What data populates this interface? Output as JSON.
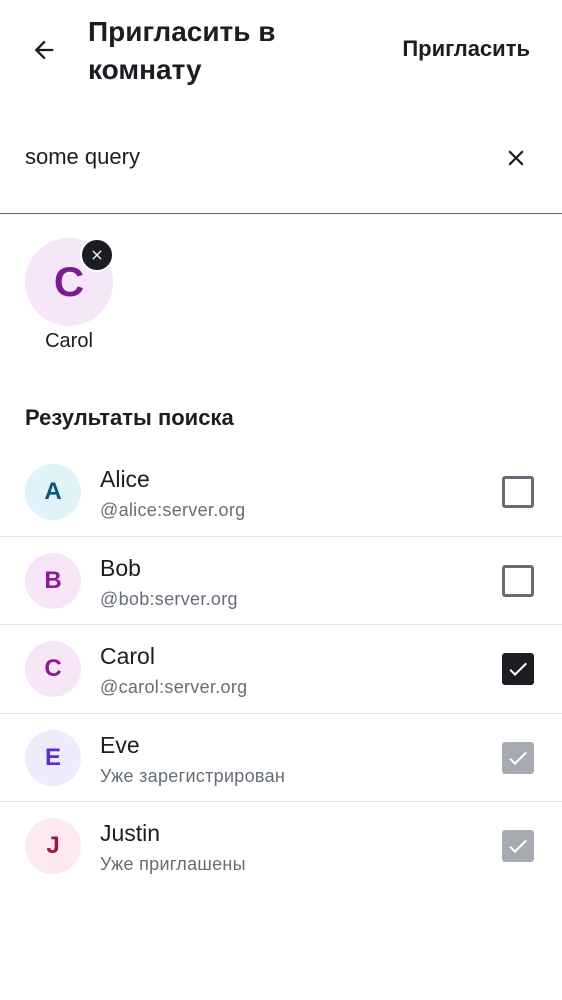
{
  "header": {
    "title": "Пригласить в комнату",
    "back_icon": "arrow-left-icon",
    "invite_label": "Пригласить"
  },
  "search": {
    "value": "some query",
    "clear_icon": "close-icon"
  },
  "selected": {
    "initial": "C",
    "name": "Carol",
    "remove_icon": "close-icon"
  },
  "results": {
    "title": "Результаты поиска",
    "items": [
      {
        "initial": "A",
        "name": "Alice",
        "subtitle": "@alice:server.org",
        "state": "unchecked",
        "avatar_bg": "#dff3f8",
        "avatar_fg": "#0a5675"
      },
      {
        "initial": "B",
        "name": "Bob",
        "subtitle": "@bob:server.org",
        "state": "unchecked",
        "avatar_bg": "#f7e6f7",
        "avatar_fg": "#8a1d94"
      },
      {
        "initial": "C",
        "name": "Carol",
        "subtitle": "@carol:server.org",
        "state": "checked",
        "avatar_bg": "#f7e6f7",
        "avatar_fg": "#8a1d94"
      },
      {
        "initial": "E",
        "name": "Eve",
        "subtitle": "Уже зарегистрирован",
        "state": "disabled",
        "avatar_bg": "#eeebfc",
        "avatar_fg": "#5b2fc7"
      },
      {
        "initial": "J",
        "name": "Justin",
        "subtitle": "Уже приглашены",
        "state": "disabled",
        "avatar_bg": "#fde9ee",
        "avatar_fg": "#a0134a"
      }
    ]
  }
}
